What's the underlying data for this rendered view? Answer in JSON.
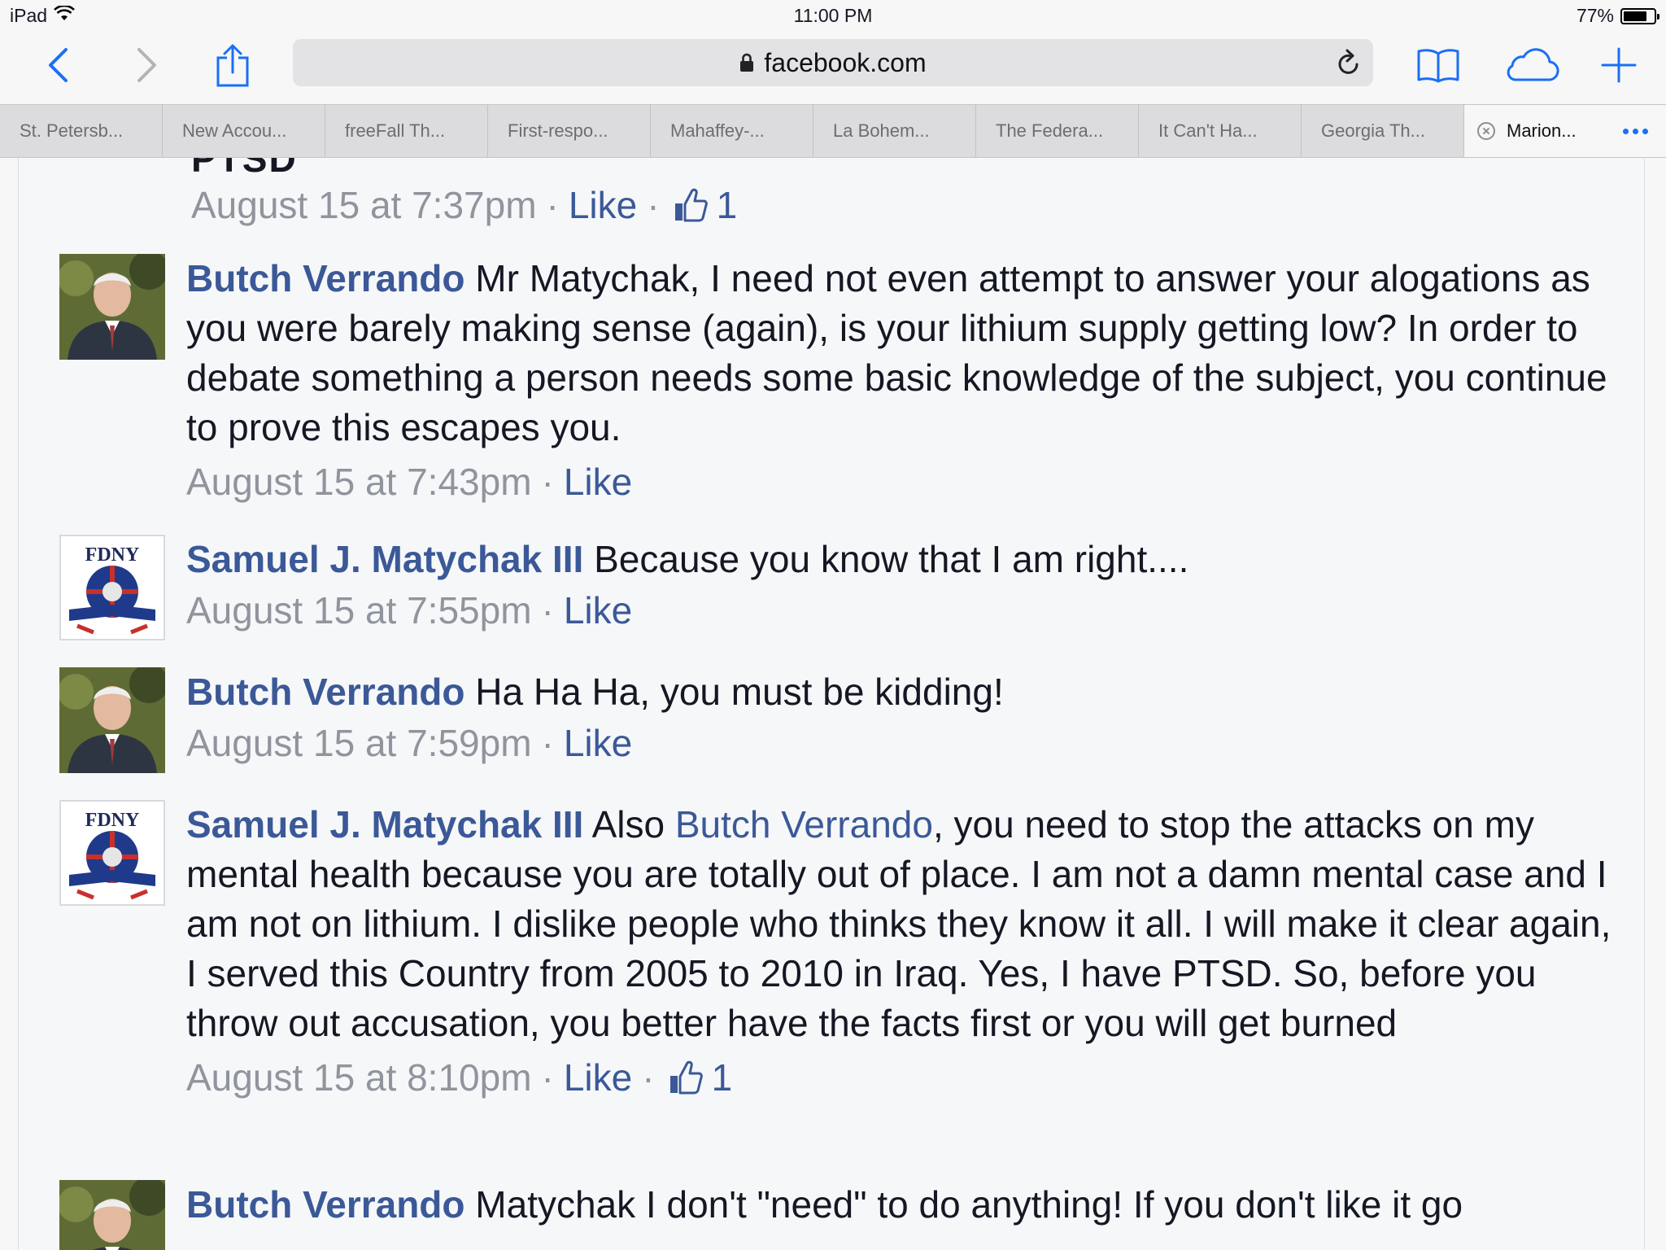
{
  "status_bar": {
    "device": "iPad",
    "time": "11:00 PM",
    "battery": "77%",
    "battery_level": 0.77
  },
  "toolbar": {
    "url": "facebook.com"
  },
  "tabs": [
    {
      "label": "St. Petersb..."
    },
    {
      "label": "New Accou..."
    },
    {
      "label": "freeFall Th..."
    },
    {
      "label": "First-respo..."
    },
    {
      "label": "Mahaffey-..."
    },
    {
      "label": "La Bohem..."
    },
    {
      "label": "The Federa..."
    },
    {
      "label": "It Can't Ha..."
    },
    {
      "label": "Georgia Th..."
    },
    {
      "label": "Marion...",
      "active": true
    }
  ],
  "thread": {
    "partial_top_text": "PTSD",
    "first_meta": {
      "time": "August 15 at 7:37pm",
      "like": "Like",
      "likes": "1"
    },
    "comments": [
      {
        "author": "Butch Verrando",
        "avatar": "butch-avatar",
        "text": "Mr Matychak, I need not even attempt to answer your alogations as you were barely making sense (again), is your lithium supply getting low? In order to debate something a person needs some basic knowledge of the subject, you continue to prove this escapes you.",
        "time": "August 15 at 7:43pm",
        "like": "Like"
      },
      {
        "author": "Samuel J. Matychak III",
        "avatar": "fdny-avatar",
        "text": "Because you know that I am right....",
        "time": "August 15 at 7:55pm",
        "like": "Like"
      },
      {
        "author": "Butch Verrando",
        "avatar": "butch-avatar",
        "text": "Ha Ha Ha, you must be kidding!",
        "time": "August 15 at 7:59pm",
        "like": "Like"
      },
      {
        "author": "Samuel J. Matychak III",
        "avatar": "fdny-avatar",
        "text_before": "Also",
        "mention": "Butch Verrando",
        "text": ", you need to stop the attacks on my mental health because you are totally out of place. I am not a damn mental case and I am not on lithium. I dislike people who thinks they know it all. I will make it clear again, I served this Country from 2005 to 2010 in Iraq. Yes, I have PTSD. So, before you throw out accusation, you better have the facts first or you will get burned",
        "time": "August 15 at 8:10pm",
        "like": "Like",
        "likes": "1"
      },
      {
        "author": "Butch Verrando",
        "avatar": "butch-avatar",
        "text": "Matychak I don't \"need\" to do anything! If you don't like it go"
      }
    ]
  },
  "colors": {
    "link": "#3b5998",
    "meta": "#90949c",
    "ios_blue": "#1a6ff5"
  }
}
